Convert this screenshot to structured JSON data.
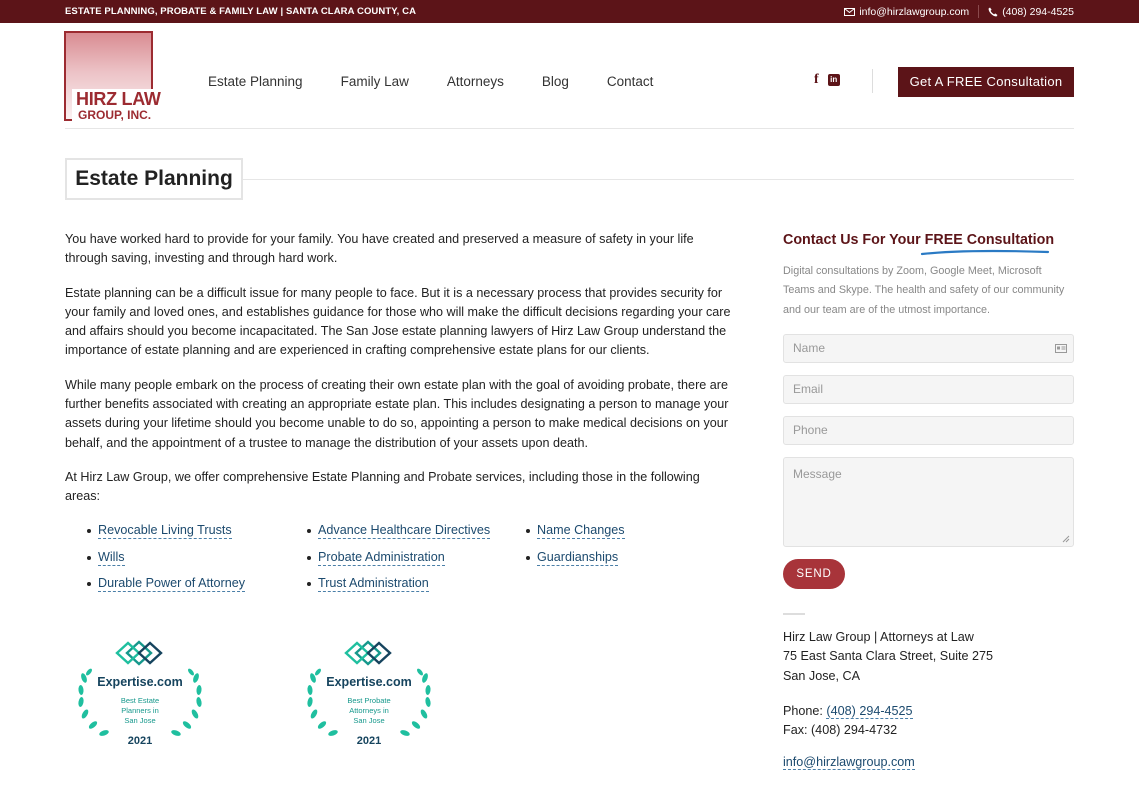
{
  "topbar": {
    "tagline": "ESTATE PLANNING,  PROBATE  &  FAMILY LAW  |  SANTA CLARA COUNTY, CA",
    "email": "info@hirzlawgroup.com",
    "phone": "(408) 294-4525",
    "email_icon": "envelope-icon",
    "phone_icon": "phone-icon"
  },
  "logo": {
    "line1": "HIRZ LAW",
    "line2": "GROUP, INC."
  },
  "nav": {
    "items": [
      "Estate Planning",
      "Family Law",
      "Attorneys",
      "Blog",
      "Contact"
    ]
  },
  "social": {
    "facebook": "f",
    "linkedin": "in"
  },
  "cta": {
    "label": "Get A FREE Consultation"
  },
  "page": {
    "title": "Estate Planning"
  },
  "main": {
    "paragraphs": [
      "You have worked hard to provide for your family. You have created and preserved a measure of safety in your life through saving, investing and through hard work.",
      "Estate planning can be a difficult issue for many people to face. But it is a necessary process that provides security for your family and loved ones, and establishes guidance for those who will make the difficult decisions regarding your care and affairs should you become incapacitated. The San Jose estate planning lawyers of Hirz Law Group understand the importance of estate planning and are experienced in crafting comprehensive estate plans for our clients.",
      "While many people embark on the process of creating their own estate plan with the goal of avoiding probate, there are further benefits associated with creating an appropriate estate plan. This includes designating a person to manage your assets during your lifetime should you become unable to do so, appointing a person to make medical decisions on your behalf, and the appointment of a trustee to manage the distribution of your assets upon death.",
      "At Hirz Law Group, we offer comprehensive Estate Planning and Probate services, including those in the following areas:"
    ],
    "services": {
      "col1": [
        "Revocable Living Trusts",
        "Wills",
        "Durable Power of Attorney"
      ],
      "col2": [
        "Advance Healthcare Directives",
        "Probate Administration",
        "Trust Administration"
      ],
      "col3": [
        "Name Changes",
        "Guardianships"
      ]
    },
    "badges": [
      {
        "brand": "Expertise.com",
        "line1": "Best Estate",
        "line2": "Planners in",
        "line3": "San Jose",
        "year": "2021"
      },
      {
        "brand": "Expertise.com",
        "line1": "Best Probate",
        "line2": "Attorneys in",
        "line3": "San Jose",
        "year": "2021"
      }
    ]
  },
  "sidebar": {
    "heading_prefix": "Contact Us For Your ",
    "heading_highlight": "FREE Consultation",
    "intro": "Digital consultations by Zoom, Google Meet, Microsoft Teams and Skype. The health and safety of our community and our team are of the utmost importance.",
    "form": {
      "name_placeholder": "Name",
      "email_placeholder": "Email",
      "phone_placeholder": "Phone",
      "message_placeholder": "Message",
      "send_label": "SEND"
    },
    "address": {
      "firm": "Hirz Law Group | Attorneys at Law",
      "street": "75 East Santa Clara Street, Suite 275",
      "city": "San Jose, CA",
      "phone_label": "Phone: ",
      "phone": "(408) 294-4525",
      "fax": "Fax: (408) 294-4732",
      "email": "info@hirzlawgroup.com"
    }
  },
  "colors": {
    "brand": "#5c1418",
    "accent": "#a8343a",
    "link": "#1c4a6e",
    "badge_teal": "#1fbf9f"
  }
}
